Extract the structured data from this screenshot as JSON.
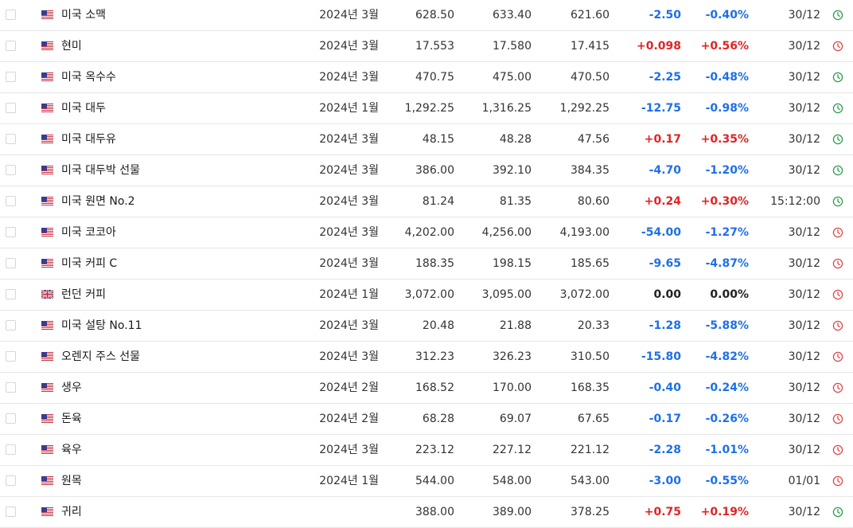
{
  "colors": {
    "negative": "#1e6fe8",
    "positive": "#e02424",
    "neutral": "#222222",
    "clock_open": "#2e9e4e",
    "clock_closed": "#e04848"
  },
  "rows": [
    {
      "name": "미국 소맥",
      "flag": "us-flag-icon",
      "month": "2024년 3월",
      "last": "628.50",
      "high": "633.40",
      "low": "621.60",
      "chg": "-2.50",
      "pct": "-0.40%",
      "time": "30/12",
      "dir": "neg",
      "clock": "open"
    },
    {
      "name": "현미",
      "flag": "us-flag-icon",
      "month": "2024년 3월",
      "last": "17.553",
      "high": "17.580",
      "low": "17.415",
      "chg": "+0.098",
      "pct": "+0.56%",
      "time": "30/12",
      "dir": "pos",
      "clock": "closed"
    },
    {
      "name": "미국 옥수수",
      "flag": "us-flag-icon",
      "month": "2024년 3월",
      "last": "470.75",
      "high": "475.00",
      "low": "470.50",
      "chg": "-2.25",
      "pct": "-0.48%",
      "time": "30/12",
      "dir": "neg",
      "clock": "open"
    },
    {
      "name": "미국 대두",
      "flag": "us-flag-icon",
      "month": "2024년 1월",
      "last": "1,292.25",
      "high": "1,316.25",
      "low": "1,292.25",
      "chg": "-12.75",
      "pct": "-0.98%",
      "time": "30/12",
      "dir": "neg",
      "clock": "open"
    },
    {
      "name": "미국 대두유",
      "flag": "us-flag-icon",
      "month": "2024년 3월",
      "last": "48.15",
      "high": "48.28",
      "low": "47.56",
      "chg": "+0.17",
      "pct": "+0.35%",
      "time": "30/12",
      "dir": "pos",
      "clock": "open"
    },
    {
      "name": "미국 대두박 선물",
      "flag": "us-flag-icon",
      "month": "2024년 3월",
      "last": "386.00",
      "high": "392.10",
      "low": "384.35",
      "chg": "-4.70",
      "pct": "-1.20%",
      "time": "30/12",
      "dir": "neg",
      "clock": "open"
    },
    {
      "name": "미국 원면 No.2",
      "flag": "us-flag-icon",
      "month": "2024년 3월",
      "last": "81.24",
      "high": "81.35",
      "low": "80.60",
      "chg": "+0.24",
      "pct": "+0.30%",
      "time": "15:12:00",
      "dir": "pos",
      "clock": "open"
    },
    {
      "name": "미국 코코아",
      "flag": "us-flag-icon",
      "month": "2024년 3월",
      "last": "4,202.00",
      "high": "4,256.00",
      "low": "4,193.00",
      "chg": "-54.00",
      "pct": "-1.27%",
      "time": "30/12",
      "dir": "neg",
      "clock": "closed"
    },
    {
      "name": "미국 커피 C",
      "flag": "us-flag-icon",
      "month": "2024년 3월",
      "last": "188.35",
      "high": "198.15",
      "low": "185.65",
      "chg": "-9.65",
      "pct": "-4.87%",
      "time": "30/12",
      "dir": "neg",
      "clock": "closed"
    },
    {
      "name": "런던 커피",
      "flag": "uk-flag-icon",
      "month": "2024년 1월",
      "last": "3,072.00",
      "high": "3,095.00",
      "low": "3,072.00",
      "chg": "0.00",
      "pct": "0.00%",
      "time": "30/12",
      "dir": "neu",
      "clock": "closed"
    },
    {
      "name": "미국 설탕 No.11",
      "flag": "us-flag-icon",
      "month": "2024년 3월",
      "last": "20.48",
      "high": "21.88",
      "low": "20.33",
      "chg": "-1.28",
      "pct": "-5.88%",
      "time": "30/12",
      "dir": "neg",
      "clock": "closed"
    },
    {
      "name": "오렌지 주스 선물",
      "flag": "us-flag-icon",
      "month": "2024년 3월",
      "last": "312.23",
      "high": "326.23",
      "low": "310.50",
      "chg": "-15.80",
      "pct": "-4.82%",
      "time": "30/12",
      "dir": "neg",
      "clock": "closed"
    },
    {
      "name": "생우",
      "flag": "us-flag-icon",
      "month": "2024년 2월",
      "last": "168.52",
      "high": "170.00",
      "low": "168.35",
      "chg": "-0.40",
      "pct": "-0.24%",
      "time": "30/12",
      "dir": "neg",
      "clock": "closed"
    },
    {
      "name": "돈육",
      "flag": "us-flag-icon",
      "month": "2024년 2월",
      "last": "68.28",
      "high": "69.07",
      "low": "67.65",
      "chg": "-0.17",
      "pct": "-0.26%",
      "time": "30/12",
      "dir": "neg",
      "clock": "closed"
    },
    {
      "name": "육우",
      "flag": "us-flag-icon",
      "month": "2024년 3월",
      "last": "223.12",
      "high": "227.12",
      "low": "221.12",
      "chg": "-2.28",
      "pct": "-1.01%",
      "time": "30/12",
      "dir": "neg",
      "clock": "closed"
    },
    {
      "name": "원목",
      "flag": "us-flag-icon",
      "month": "2024년 1월",
      "last": "544.00",
      "high": "548.00",
      "low": "543.00",
      "chg": "-3.00",
      "pct": "-0.55%",
      "time": "01/01",
      "dir": "neg",
      "clock": "closed"
    },
    {
      "name": "귀리",
      "flag": "us-flag-icon",
      "month": "",
      "last": "388.00",
      "high": "389.00",
      "low": "378.25",
      "chg": "+0.75",
      "pct": "+0.19%",
      "time": "30/12",
      "dir": "pos",
      "clock": "open"
    }
  ]
}
